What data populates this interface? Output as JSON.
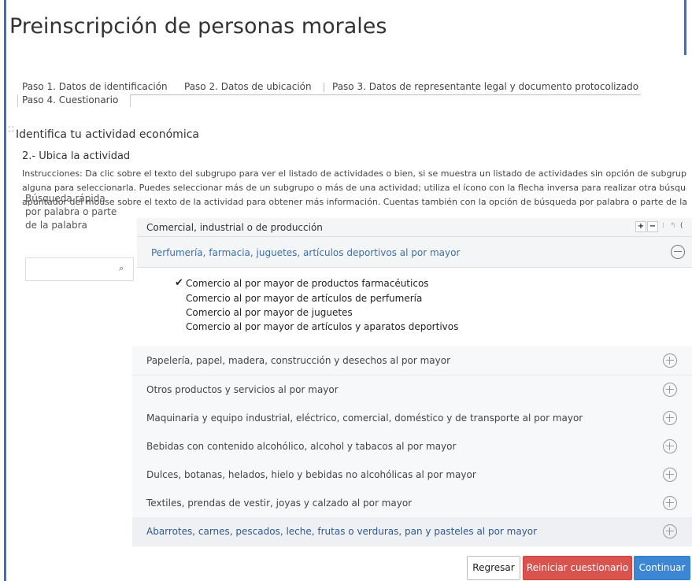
{
  "page": {
    "title": "Preinscripción de personas morales"
  },
  "tabs": [
    {
      "label": "Paso 1. Datos de identificación"
    },
    {
      "label": "Paso 2. Datos de ubicación"
    },
    {
      "label": "Paso 3. Datos de representante legal y documento protocolizado"
    },
    {
      "label": "Paso 4. Cuestionario"
    }
  ],
  "section": {
    "icon": "expand-icon",
    "title": "Identifica tu actividad económica",
    "subtitle": "2.- Ubica la actividad",
    "instructions": [
      "Instrucciones: Da clic sobre el texto del subgrupo para ver el listado de actividades o bien, si se muestra un listado de actividades sin opción de subgrupos, da clic so",
      "alguna para seleccionarla. Puedes seleccionar más de un subgrupo o más de una actividad; utiliza el ícono con la flecha inversa para realizar otra búsqueda. Pas",
      "apuntador del mouse sobre el texto de la actividad para obtener más información. Cuentas también con la opción de búsqueda por palabra o parte de la palabra."
    ]
  },
  "search": {
    "label": "Búsqueda rápida por palabra o parte de la palabra",
    "value": "",
    "placeholder": "",
    "icon": "search-icon"
  },
  "group": {
    "label": "Comercial, industrial o de producción",
    "tools": {
      "add": "+",
      "remove": "−",
      "mini1": "⁞",
      "mini2": "↰",
      "mini3": "("
    }
  },
  "expanded": {
    "label": "Perfumería, farmacia, juguetes, artículos deportivos al por mayor",
    "activities": [
      {
        "label": "Comercio al por mayor de productos farmacéuticos",
        "checked": true
      },
      {
        "label": "Comercio al por mayor de artículos de perfumería",
        "checked": false
      },
      {
        "label": "Comercio al por mayor de juguetes",
        "checked": false
      },
      {
        "label": "Comercio al por mayor de artículos y aparatos deportivos",
        "checked": false
      }
    ]
  },
  "subgroups": [
    {
      "label": "Papelería, papel, madera, construcción y desechos al por mayor"
    },
    {
      "label": "Otros productos y servicios al por mayor"
    },
    {
      "label": "Maquinaria y equipo industrial, eléctrico, comercial, doméstico y de transporte al por mayor"
    },
    {
      "label": "Bebidas con contenido alcohólico, alcohol y tabacos al por mayor"
    },
    {
      "label": "Dulces, botanas, helados, hielo y bebidas no alcohólicas al por mayor"
    },
    {
      "label": "Textiles, prendas de vestir, joyas y calzado al por mayor"
    },
    {
      "label": "Abarrotes, carnes, pescados, leche, frutas o verduras, pan y pasteles al por mayor"
    }
  ],
  "buttons": {
    "back": "Regresar",
    "reset": "Reiniciar cuestionario",
    "continue": "Continuar"
  },
  "colors": {
    "frame": "#3b6fc4",
    "reset": "#d9534f",
    "continue": "#3c86d3",
    "link": "#3d6fa8"
  }
}
